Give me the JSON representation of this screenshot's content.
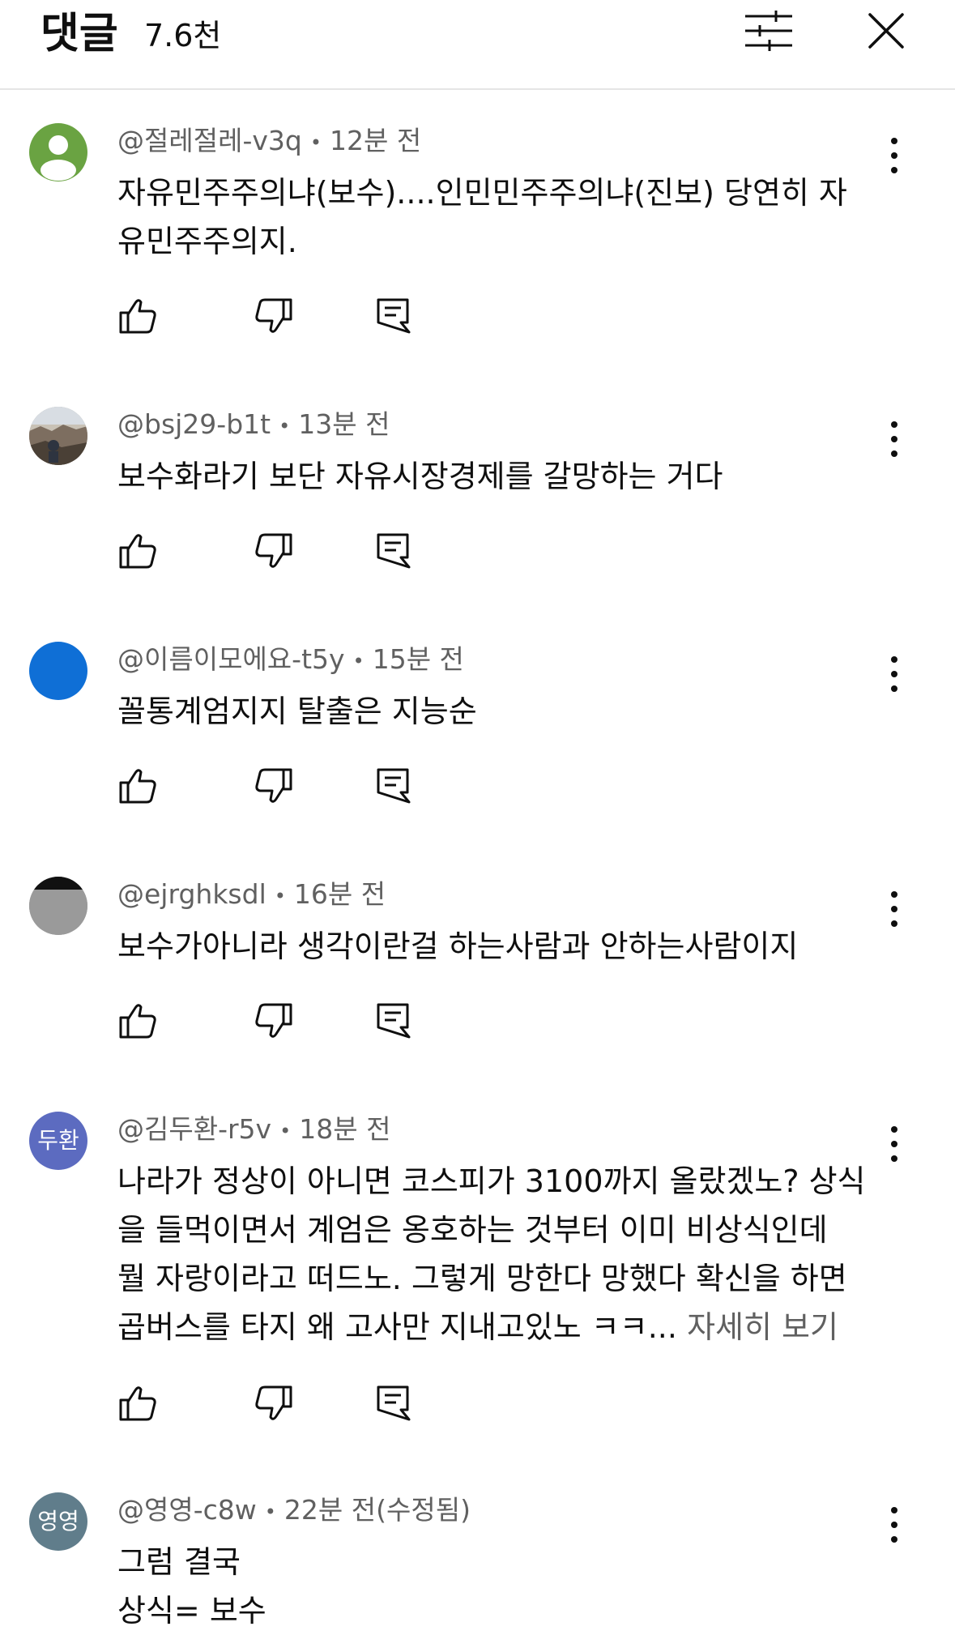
{
  "header": {
    "title": "댓글",
    "count": "7.6천",
    "icons": [
      "filter-sliders-icon",
      "close-icon"
    ]
  },
  "colors": {
    "meta_text": "#606060",
    "body_text": "#0f0f0f",
    "divider": "#e5e5e5",
    "avatar_green": "#6aa342",
    "avatar_blue": "#0f6fd6",
    "avatar_indigo": "#5c6bc0",
    "avatar_slate": "#607d8b"
  },
  "comments": [
    {
      "author": "@절레절레-v3q",
      "time": "12분 전",
      "lines": [
        "자유민주주의냐(보수)....인민민주주의냐(진보) 당연히 자",
        "유민주주의지."
      ],
      "avatar": "default-person-icon"
    },
    {
      "author": "@bsj29-b1t",
      "time": "13분 전",
      "lines": [
        "보수화라기 보단 자유시장경제를 갈망하는 거다"
      ],
      "avatar": "photo-avatar"
    },
    {
      "author": "@이름이모에요-t5y",
      "time": "15분 전",
      "lines": [
        "꼴통계엄지지 탈출은 지능순"
      ],
      "avatar": "blue-circle-avatar"
    },
    {
      "author": "@ejrghksdl",
      "time": "16분 전",
      "lines": [
        "보수가아니라 생각이란걸 하는사람과 안하는사람이지"
      ],
      "avatar": "gray-photo-avatar"
    },
    {
      "author": "@김두환-r5v",
      "time": "18분 전",
      "avatar_text": "두환",
      "lines": [
        "나라가 정상이 아니면 코스피가 3100까지 올랐겠노? 상식",
        "을 들먹이면서 계엄은 옹호하는 것부터 이미 비상식인데",
        "뭘 자랑이라고 떠드노. 그렇게 망한다 망했다 확신을 하면",
        "곱버스를 타지 왜 고사만 지내고있노 ㅋㅋ..."
      ],
      "read_more": "자세히 보기"
    },
    {
      "author": "@영영-c8w",
      "time": "22분 전(수정됨)",
      "avatar_text": "영영",
      "lines": [
        "그럼 결국",
        "상식= 보수"
      ]
    }
  ],
  "action_icons": [
    "thumbs-up-icon",
    "thumbs-down-icon",
    "reply-icon"
  ]
}
